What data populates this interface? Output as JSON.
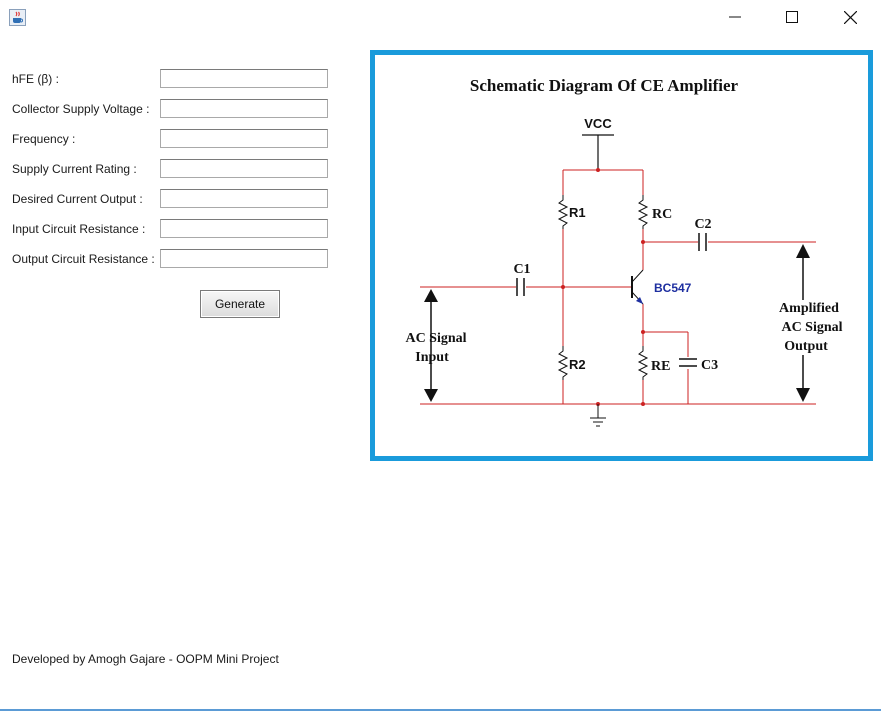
{
  "window": {
    "controls": [
      "minimize-icon",
      "maximize-icon",
      "close-icon"
    ],
    "app_icon": "java-cup-icon"
  },
  "form": {
    "fields": [
      {
        "label": "hFE (β) :",
        "value": ""
      },
      {
        "label": "Collector Supply Voltage :",
        "value": ""
      },
      {
        "label": "Frequency :",
        "value": ""
      },
      {
        "label": "Supply Current Rating :",
        "value": ""
      },
      {
        "label": "Desired Current Output :",
        "value": ""
      },
      {
        "label": "Input Circuit Resistance :",
        "value": ""
      },
      {
        "label": "Output Circuit Resistance :",
        "value": ""
      }
    ],
    "generate_label": "Generate"
  },
  "schematic": {
    "title": "Schematic Diagram Of CE Amplifier",
    "vcc": "VCC",
    "r1": "R1",
    "r2": "R2",
    "rc": "RC",
    "re": "RE",
    "c1": "C1",
    "c2": "C2",
    "c3": "C3",
    "transistor": "BC547",
    "input_line1": "AC Signal",
    "input_line2": "Input",
    "output_line1": "Amplified",
    "output_line2": "AC Signal",
    "output_line3": "Output",
    "border_color": "#1a9bdb",
    "wire_color": "#cc2222"
  },
  "footer": {
    "text": "Developed by Amogh Gajare - OOPM Mini Project"
  }
}
